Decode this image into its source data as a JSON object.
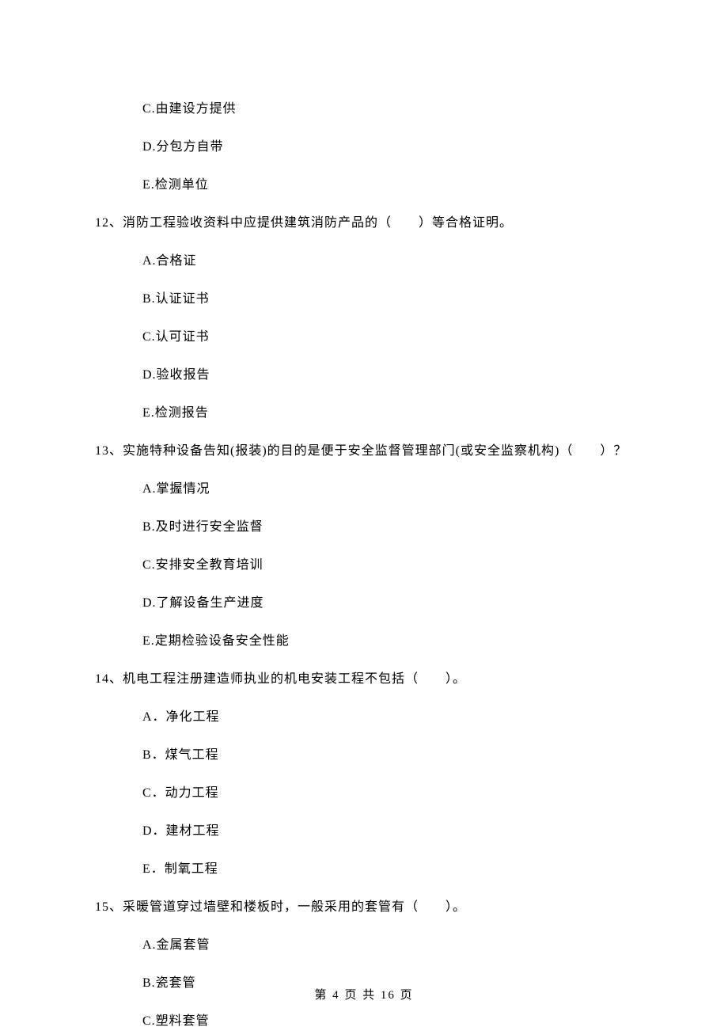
{
  "orphan_options": [
    "C.由建设方提供",
    "D.分包方自带",
    "E.检测单位"
  ],
  "questions": [
    {
      "stem": "12、消防工程验收资料中应提供建筑消防产品的（　　）等合格证明。",
      "options": [
        "A.合格证",
        "B.认证证书",
        "C.认可证书",
        "D.验收报告",
        "E.检测报告"
      ]
    },
    {
      "stem": "13、实施特种设备告知(报装)的目的是便于安全监督管理部门(或安全监察机构)（　　）？",
      "options": [
        "A.掌握情况",
        "B.及时进行安全监督",
        "C.安排安全教育培训",
        "D.了解设备生产进度",
        "E.定期检验设备安全性能"
      ]
    },
    {
      "stem": "14、机电工程注册建造师执业的机电安装工程不包括（　　）。",
      "options": [
        "A．净化工程",
        "B．煤气工程",
        "C．动力工程",
        "D．建材工程",
        "E．制氧工程"
      ]
    },
    {
      "stem": "15、采暖管道穿过墙壁和楼板时，一般采用的套管有（　　）。",
      "options": [
        "A.金属套管",
        "B.瓷套管",
        "C.塑料套管"
      ]
    }
  ],
  "footer": "第 4 页 共 16 页"
}
